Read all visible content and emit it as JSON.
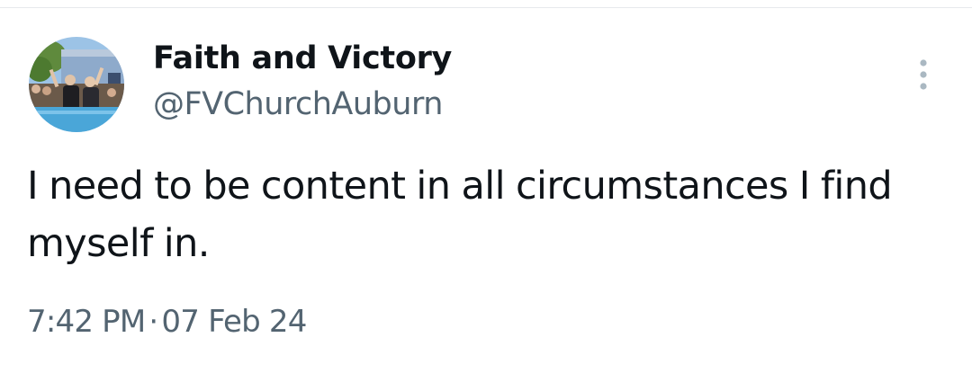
{
  "tweet": {
    "author": {
      "display_name": "Faith and Victory",
      "handle": "@FVChurchAuburn",
      "avatar_icon": "profile-photo-baptism"
    },
    "text": "I need to be content in all circumstances I find myself in.",
    "time": "7:42 PM",
    "separator": "·",
    "date": "07 Feb 24",
    "more_icon": "vertical-ellipsis-icon"
  },
  "colors": {
    "primary_text": "#0f1419",
    "secondary_text": "#536471",
    "more_icon": "#aab8c2",
    "divider": "#e6e9ec",
    "background": "#ffffff"
  }
}
